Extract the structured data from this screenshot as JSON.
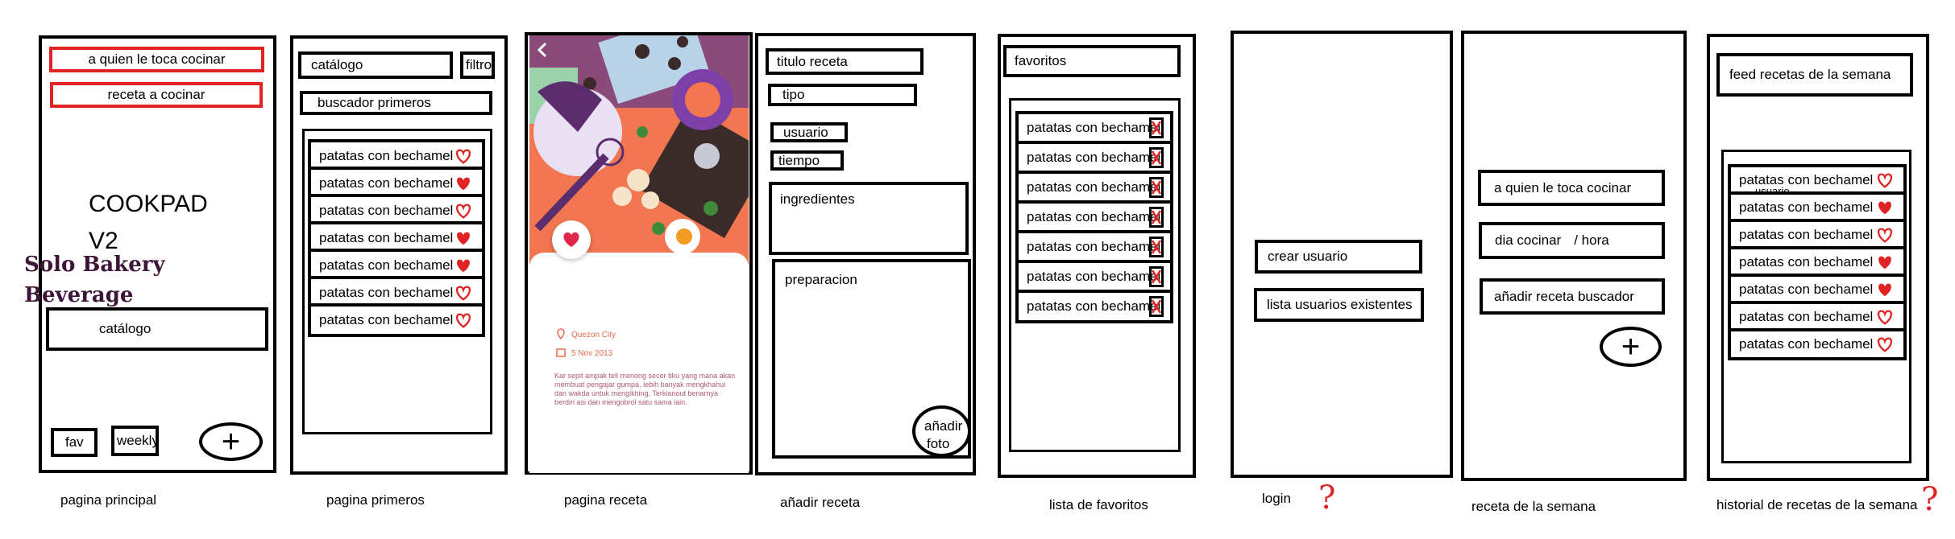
{
  "colors": {
    "accent_red": "#e02424",
    "recipe_title": "#3d1538",
    "recipe_meta": "#e86a4a"
  },
  "screens": {
    "pagina_principal": {
      "caption": "pagina principal",
      "btn_turn": "a quien le toca cocinar",
      "btn_recipe": "receta a cocinar",
      "app_title_1": "COOKPAD",
      "app_title_2": "V2",
      "catalog": "catálogo",
      "fav": "fav",
      "weekly": "weekly",
      "add_icon": "plus-icon"
    },
    "pagina_primeros": {
      "caption": "pagina primeros",
      "catalog": "catálogo",
      "filter": "filtro",
      "search": "buscador primeros",
      "items": [
        {
          "label": "patatas con bechamel",
          "fav": false
        },
        {
          "label": "patatas con bechamel",
          "fav": true
        },
        {
          "label": "patatas con bechamel",
          "fav": false
        },
        {
          "label": "patatas con bechamel",
          "fav": true
        },
        {
          "label": "patatas con bechamel",
          "fav": true
        },
        {
          "label": "patatas con bechamel",
          "fav": false
        },
        {
          "label": "patatas con bechamel",
          "fav": false
        }
      ]
    },
    "pagina_receta": {
      "caption": "pagina receta",
      "title": "Solo Bakery Beverage",
      "location": "Quezon City",
      "date": "5 Nov 2013",
      "body": "Kar sepit ampak tell menong secer tiku yang mana akan membuat pengajar gumpa. lebih banyak mengkhahui dan wakda untuk mengikhing. Terkianout benarnya berdiri asi dan mengobrol satu sama lain."
    },
    "anadir_receta": {
      "caption": "añadir receta",
      "titulo": "titulo receta",
      "tipo": "tipo",
      "usuario": "usuario",
      "tiempo": "tiempo",
      "ingredientes": "ingredientes",
      "preparacion": "preparacion",
      "foto_1": "añadir",
      "foto_2": "foto"
    },
    "lista_favoritos": {
      "caption": "lista de favoritos",
      "header": "favoritos",
      "items": [
        "patatas con bechamel",
        "patatas con bechamel",
        "patatas con bechamel",
        "patatas con bechamel",
        "patatas con bechamel",
        "patatas con bechamel",
        "patatas con bechamel"
      ]
    },
    "login": {
      "caption": "login",
      "crear": "crear usuario",
      "lista": "lista usuarios existentes",
      "mark": "?"
    },
    "receta_semana": {
      "caption": "receta de la semana",
      "turno": "a quien le toca cocinar",
      "dia": "dia cocinar",
      "hora": "/ hora",
      "anadir": "añadir receta buscador",
      "add_icon": "plus-icon"
    },
    "historial": {
      "caption": "historial de recetas de la semana",
      "feed": "feed recetas de la semana",
      "first_sub": "usuario",
      "items": [
        {
          "label": "patatas con bechamel",
          "fav": false
        },
        {
          "label": "patatas con bechamel",
          "fav": true
        },
        {
          "label": "patatas con bechamel",
          "fav": false
        },
        {
          "label": "patatas con bechamel",
          "fav": true
        },
        {
          "label": "patatas con bechamel",
          "fav": true
        },
        {
          "label": "patatas con bechamel",
          "fav": false
        },
        {
          "label": "patatas con bechamel",
          "fav": false
        }
      ],
      "mark": "?"
    }
  }
}
